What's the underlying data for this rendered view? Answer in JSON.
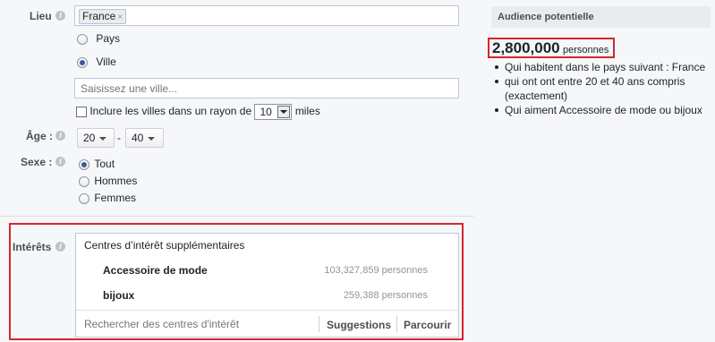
{
  "location": {
    "label": "Lieu",
    "token": "France",
    "token_remove": "×",
    "options": [
      {
        "label": "Pays",
        "selected": false
      },
      {
        "label": "Ville",
        "selected": true
      }
    ],
    "city_placeholder": "Saisissez une ville...",
    "radius_prefix": "Inclure les villes dans un rayon de",
    "radius_value": "10",
    "radius_unit": "miles"
  },
  "age": {
    "label": "Âge :",
    "min": "20",
    "separator": "-",
    "max": "40"
  },
  "gender": {
    "label": "Sexe :",
    "options": [
      {
        "label": "Tout",
        "selected": true
      },
      {
        "label": "Hommes",
        "selected": false
      },
      {
        "label": "Femmes",
        "selected": false
      }
    ]
  },
  "interests": {
    "label": "Intérêts",
    "header": "Centres d’intérêt supplémentaires",
    "items": [
      {
        "name": "Accessoire de mode",
        "count": "103,327,859 personnes"
      },
      {
        "name": "bijoux",
        "count": "259,388 personnes"
      }
    ],
    "search_placeholder": "Rechercher des centres d'intérêt",
    "suggestions": "Suggestions",
    "browse": "Parcourir"
  },
  "audience": {
    "title": "Audience potentielle",
    "count": "2,800,000",
    "unit": "personnes",
    "criteria": [
      "Qui habitent dans le pays suivant : France",
      "qui ont ont entre 20 et 40 ans compris (exactement)",
      "Qui aiment Accessoire de mode ou bijoux"
    ]
  },
  "colors": {
    "highlight_border": "#d5262f",
    "accent": "#3b5998"
  },
  "icons": {
    "info": "i"
  }
}
